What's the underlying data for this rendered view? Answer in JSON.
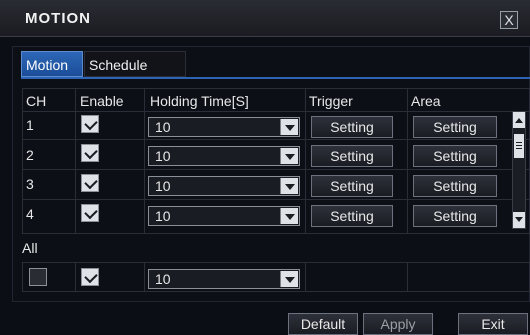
{
  "window": {
    "title": "MOTION",
    "close_glyph": "X"
  },
  "tabs": [
    {
      "label": "Motion",
      "active": true
    },
    {
      "label": "Schedule",
      "active": false
    }
  ],
  "table": {
    "headers": {
      "ch": "CH",
      "enable": "Enable",
      "holding": "Holding Time[S]",
      "trigger": "Trigger",
      "area": "Area"
    },
    "rows": [
      {
        "ch": "1",
        "enable": true,
        "holding": "10",
        "trigger": "Setting",
        "area": "Setting"
      },
      {
        "ch": "2",
        "enable": true,
        "holding": "10",
        "trigger": "Setting",
        "area": "Setting"
      },
      {
        "ch": "3",
        "enable": true,
        "holding": "10",
        "trigger": "Setting",
        "area": "Setting"
      },
      {
        "ch": "4",
        "enable": true,
        "holding": "10",
        "trigger": "Setting",
        "area": "Setting"
      }
    ]
  },
  "all": {
    "label": "All",
    "enable": true,
    "holding": "10"
  },
  "footer": {
    "default_label": "Default",
    "apply_label": "Apply",
    "exit_label": "Exit"
  },
  "icons": {
    "close": "close-icon",
    "check": "check-icon",
    "dropdown": "chevron-down-icon",
    "scroll_up": "scroll-up-icon",
    "scroll_down": "scroll-down-icon"
  },
  "colors": {
    "accent": "#2c63b4",
    "titlebar": "#23252b",
    "background": "#0c0e16"
  }
}
